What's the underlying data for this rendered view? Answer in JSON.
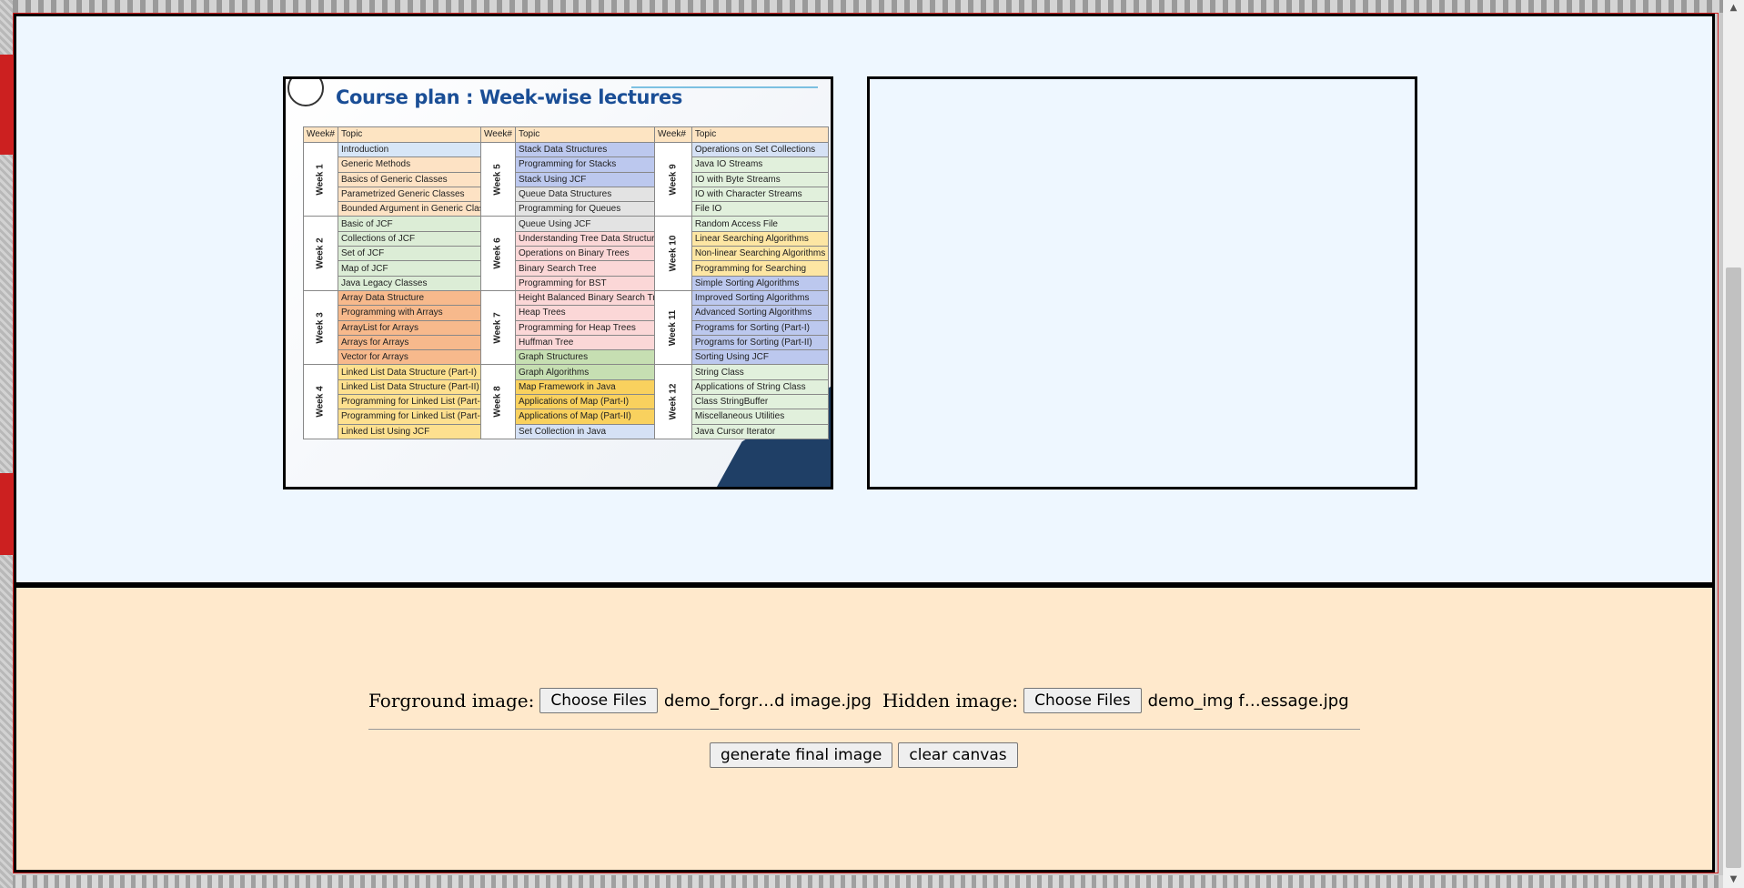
{
  "canvas": {
    "foreground_image": {
      "title": "Course plan : Week-wise lectures",
      "header_week": "Week#",
      "header_topic": "Topic",
      "tables": [
        {
          "weeks": [
            {
              "label": "Week 1",
              "topics": [
                "Introduction",
                "Generic Methods",
                "Basics of Generic Classes",
                "Parametrized Generic Classes",
                "Bounded Argument in Generic Classes"
              ],
              "colors": [
                "blue",
                "peach",
                "peach",
                "peach",
                "peach"
              ]
            },
            {
              "label": "Week 2",
              "topics": [
                "Basic of JCF",
                "Collections of JCF",
                "Set of JCF",
                "Map of JCF",
                "Java Legacy Classes"
              ],
              "colors": [
                "green",
                "green",
                "green",
                "green",
                "green"
              ]
            },
            {
              "label": "Week 3",
              "topics": [
                "Array Data Structure",
                "Programming with Arrays",
                "ArrayList for Arrays",
                "Arrays for Arrays",
                "Vector for Arrays"
              ],
              "colors": [
                "orange",
                "orange",
                "orange",
                "orange",
                "orange"
              ]
            },
            {
              "label": "Week 4",
              "topics": [
                "Linked List Data Structure (Part-I)",
                "Linked List Data Structure (Part-II)",
                "Programming for Linked List (Part-I)",
                "Programming for Linked List (Part-II)",
                "Linked List Using JCF"
              ],
              "colors": [
                "gold",
                "gold",
                "gold",
                "gold",
                "gold"
              ]
            }
          ]
        },
        {
          "weeks": [
            {
              "label": "Week 5",
              "topics": [
                "Stack Data Structures",
                "Programming for Stacks",
                "Stack Using JCF",
                "Queue Data Structures",
                "Programming for Queues"
              ],
              "colors": [
                "periwinkle",
                "periwinkle",
                "periwinkle",
                "grey",
                "grey"
              ]
            },
            {
              "label": "Week 6",
              "topics": [
                "Queue Using JCF",
                "Understanding Tree Data Structures",
                "Operations on Binary Trees",
                "Binary Search Tree",
                "Programming for BST"
              ],
              "colors": [
                "grey",
                "pink",
                "pink",
                "pink",
                "pink"
              ]
            },
            {
              "label": "Week 7",
              "topics": [
                "Height Balanced Binary Search Tree",
                "Heap Trees",
                "Programming for Heap Trees",
                "Huffman Tree",
                "Graph Structures"
              ],
              "colors": [
                "pink",
                "pink",
                "pink",
                "pink",
                "olive"
              ]
            },
            {
              "label": "Week 8",
              "topics": [
                "Graph Algorithms",
                "Map Framework in Java",
                "Applications of Map (Part-I)",
                "Applications of Map (Part-II)",
                "Set Collection in Java"
              ],
              "colors": [
                "olive",
                "amber",
                "amber",
                "amber",
                "lightblue"
              ]
            }
          ]
        },
        {
          "weeks": [
            {
              "label": "Week 9",
              "topics": [
                "Operations on Set Collections",
                "Java IO Streams",
                "IO with Byte Streams",
                "IO with Character Streams",
                "File IO"
              ],
              "colors": [
                "lightblue",
                "mint",
                "mint",
                "mint",
                "mint"
              ]
            },
            {
              "label": "Week 10",
              "topics": [
                "Random Access File",
                "Linear Searching Algorithms",
                "Non-linear Searching Algorithms",
                "Programming for Searching",
                "Simple Sorting Algorithms"
              ],
              "colors": [
                "mint",
                "yellow",
                "yellow",
                "yellow",
                "periwinkle"
              ]
            },
            {
              "label": "Week 11",
              "topics": [
                "Improved Sorting Algorithms",
                "Advanced Sorting Algorithms",
                "Programs for Sorting (Part-I)",
                "Programs for Sorting (Part-II)",
                "Sorting Using JCF"
              ],
              "colors": [
                "periwinkle",
                "periwinkle",
                "periwinkle",
                "periwinkle",
                "periwinkle"
              ]
            },
            {
              "label": "Week 12",
              "topics": [
                "String Class",
                "Applications of String Class",
                "Class StringBuffer",
                "Miscellaneous Utilities",
                "Java Cursor Iterator"
              ],
              "colors": [
                "mint",
                "mint",
                "mint",
                "mint",
                "mint"
              ]
            }
          ]
        }
      ]
    }
  },
  "controls": {
    "foreground_label": "Forground image:",
    "foreground_button": "Choose Files",
    "foreground_filename": "demo_forgr…d image.jpg",
    "hidden_label": "Hidden image:",
    "hidden_button": "Choose Files",
    "hidden_filename": "demo_img f…essage.jpg",
    "generate_button": "generate final image",
    "clear_button": "clear canvas"
  },
  "colors": {
    "canvas_bg": "#eef7ff",
    "controls_bg": "#ffe9cc",
    "frame_border": "#d32020",
    "slide_title": "#1a4e96"
  }
}
